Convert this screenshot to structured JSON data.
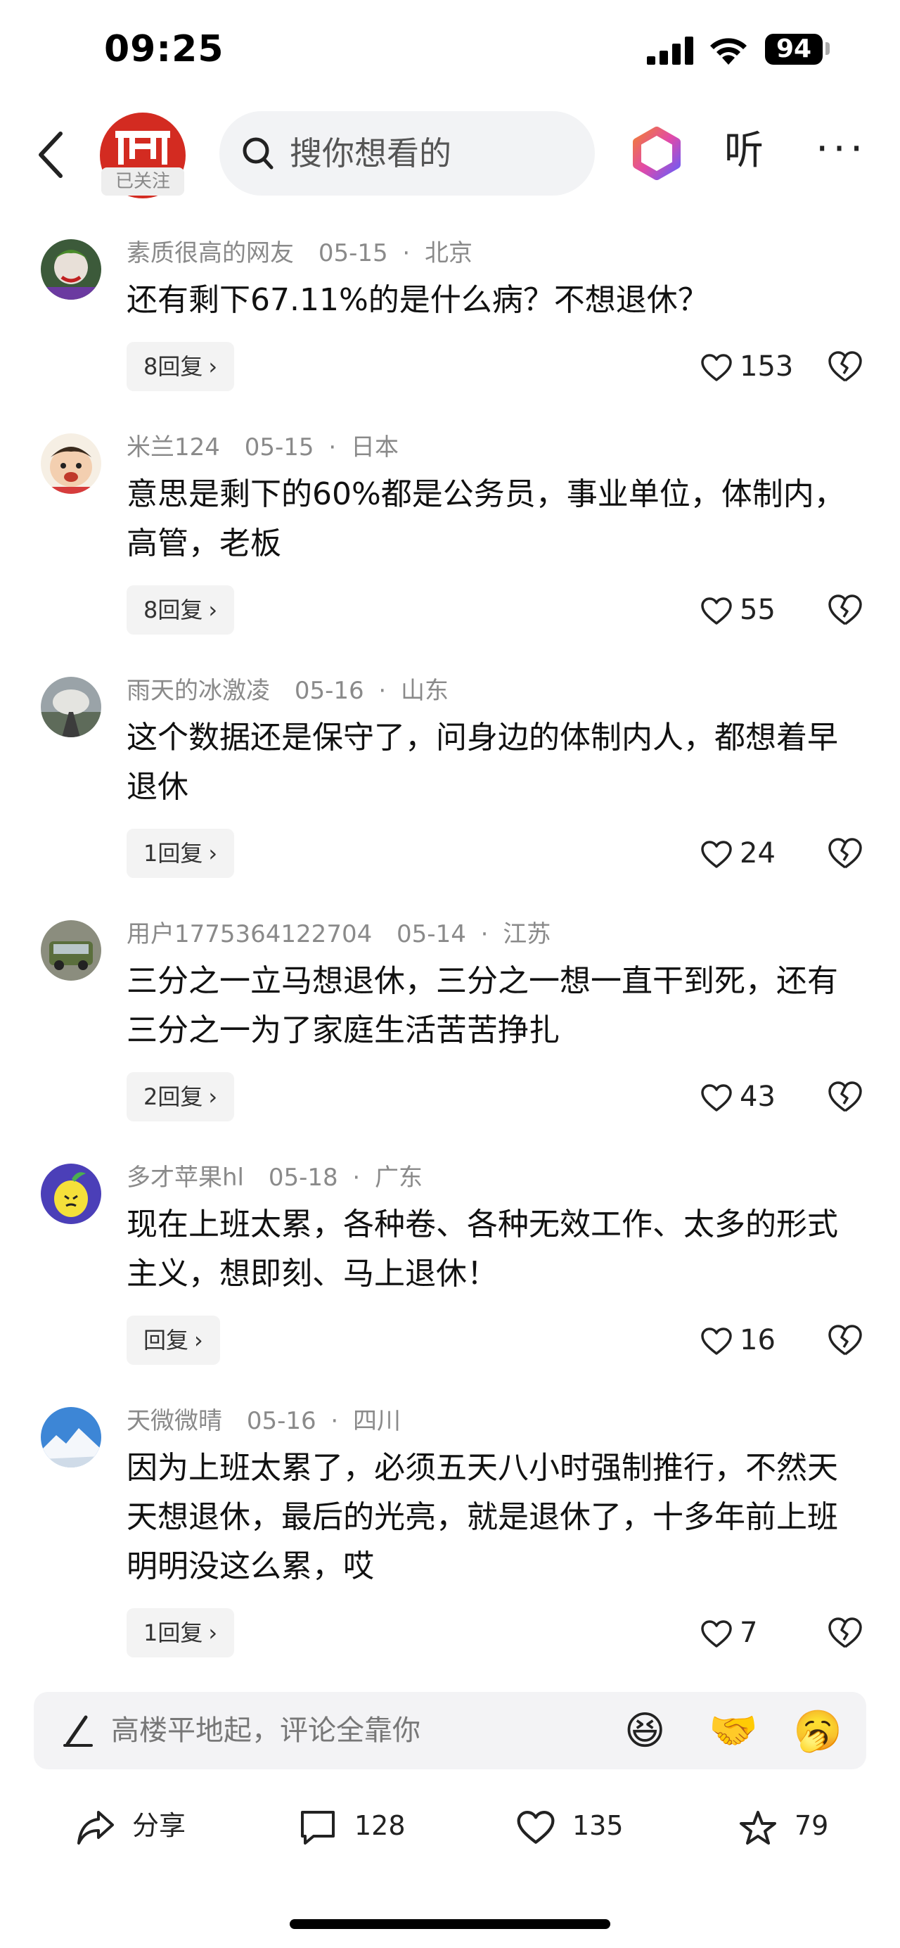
{
  "status_bar": {
    "time": "09:25",
    "battery": "94"
  },
  "nav": {
    "follow_label": "已关注",
    "search_placeholder": "搜你想看的",
    "listen_label": "听",
    "more_label": "···"
  },
  "comments": [
    {
      "user": "素质很高的网友",
      "date": "05-15",
      "location": "北京",
      "text": "还有剩下67.11%的是什么病？不想退休？",
      "replies": "8回复",
      "likes": "153"
    },
    {
      "user": "米兰124",
      "date": "05-15",
      "location": "日本",
      "text": "意思是剩下的60%都是公务员，事业单位，体制内，高管，老板",
      "replies": "8回复",
      "likes": "55"
    },
    {
      "user": "雨天的冰激凌",
      "date": "05-16",
      "location": "山东",
      "text": "这个数据还是保守了，问身边的体制内人，都想着早退休",
      "replies": "1回复",
      "likes": "24"
    },
    {
      "user": "用户1775364122704",
      "date": "05-14",
      "location": "江苏",
      "text": "三分之一立马想退休，三分之一想一直干到死，还有三分之一为了家庭生活苦苦挣扎",
      "replies": "2回复",
      "likes": "43"
    },
    {
      "user": "多才苹果hl",
      "date": "05-18",
      "location": "广东",
      "text": "现在上班太累，各种卷、各种无效工作、太多的形式主义，想即刻、马上退休！",
      "replies": "回复",
      "likes": "16"
    },
    {
      "user": "天微微晴",
      "date": "05-16",
      "location": "四川",
      "text": "因为上班太累了，必须五天八小时强制推行，不然天天想退休，最后的光亮，就是退休了，十多年前上班明明没这么累，哎",
      "replies": "1回复",
      "likes": "7"
    }
  ],
  "comment_input": {
    "placeholder": "高楼平地起，评论全靠你",
    "emojis": [
      "😆",
      "🤝",
      "🥱"
    ]
  },
  "action_bar": {
    "share": "分享",
    "comments": "128",
    "likes": "135",
    "favorites": "79"
  },
  "colors": {
    "brand_red": "#d32b21",
    "meta_gray": "#8a8a8a",
    "pill_bg": "#f3f3f3"
  }
}
